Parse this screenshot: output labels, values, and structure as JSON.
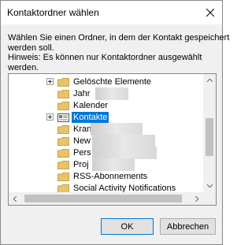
{
  "titlebar": {
    "title": "Kontaktordner wählen",
    "close_icon": "close-icon"
  },
  "instructions": {
    "line1": "Wählen Sie einen Ordner, in dem der Kontakt gespeichert",
    "line2": "werden soll.",
    "line3": "Hinweis: Es können nur Kontaktordner ausgewählt",
    "line4": "werden."
  },
  "tree": {
    "rows": [
      {
        "label": "Gelöschte Elemente",
        "expander": true,
        "selected": false
      },
      {
        "label": "Jahr",
        "expander": false,
        "selected": false
      },
      {
        "label": "Kalender",
        "expander": false,
        "selected": false
      },
      {
        "label": "Kontakte",
        "expander": true,
        "selected": true
      },
      {
        "label": "Kran",
        "expander": false,
        "selected": false
      },
      {
        "label": "New",
        "expander": false,
        "selected": false
      },
      {
        "label": "Pers",
        "expander": false,
        "selected": false
      },
      {
        "label": "Proj",
        "expander": false,
        "selected": false
      },
      {
        "label": "RSS-Abonnements",
        "expander": false,
        "selected": false
      },
      {
        "label": "Social Activity Notifications",
        "expander": false,
        "selected": false
      }
    ]
  },
  "buttons": {
    "ok": "OK",
    "cancel": "Abbrechen"
  },
  "colors": {
    "selection": "#0078d7",
    "folder": "#e8c36a",
    "background": "#f0f0f0"
  }
}
